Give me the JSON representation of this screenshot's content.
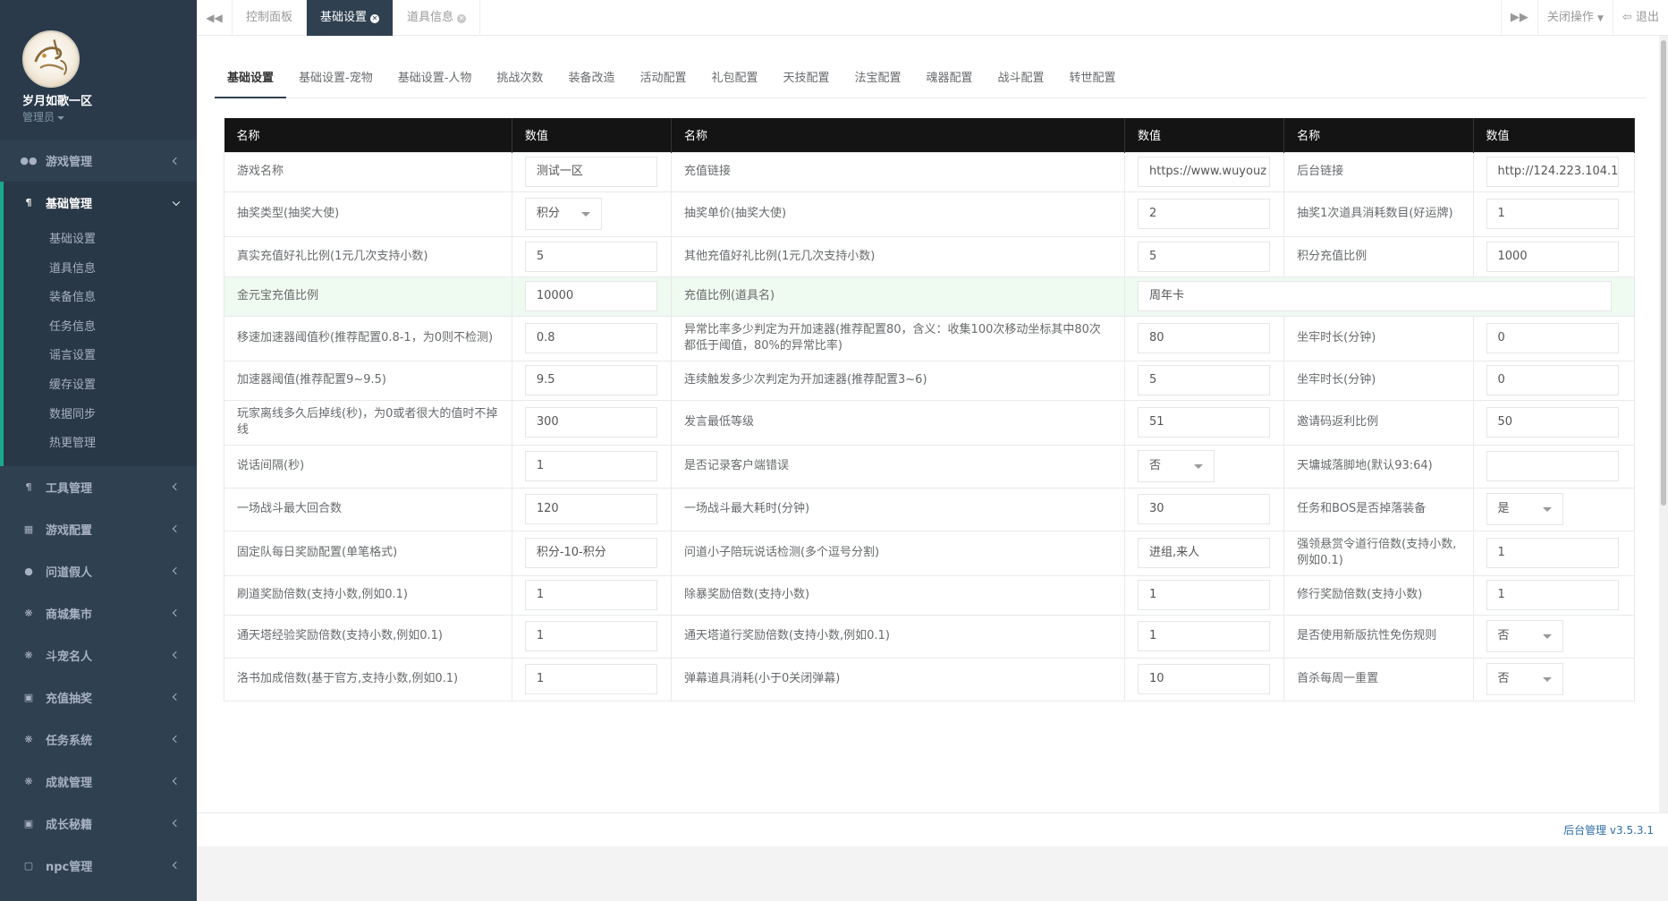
{
  "sidebar": {
    "profile": {
      "name": "岁月如歌一区",
      "role": "管理员"
    },
    "items": [
      {
        "label": "游戏管理",
        "icon": "gamepad-icon",
        "active": false
      },
      {
        "label": "基础管理",
        "icon": "cutlery-icon",
        "active": true
      },
      {
        "label": "工具管理",
        "icon": "cutlery-icon",
        "active": false
      },
      {
        "label": "游戏配置",
        "icon": "grid-icon",
        "active": false
      },
      {
        "label": "问道假人",
        "icon": "user-icon",
        "active": false
      },
      {
        "label": "商城集市",
        "icon": "gear-icon",
        "active": false
      },
      {
        "label": "斗宠名人",
        "icon": "gear-icon",
        "active": false
      },
      {
        "label": "充值抽奖",
        "icon": "money-icon",
        "active": false
      },
      {
        "label": "任务系统",
        "icon": "gear-icon",
        "active": false
      },
      {
        "label": "成就管理",
        "icon": "gear-icon",
        "active": false
      },
      {
        "label": "成长秘籍",
        "icon": "money-icon",
        "active": false
      },
      {
        "label": "npc管理",
        "icon": "square-icon",
        "active": false
      }
    ],
    "submenu": [
      "基础设置",
      "道具信息",
      "装备信息",
      "任务信息",
      "谣言设置",
      "缓存设置",
      "数据同步",
      "热更管理"
    ]
  },
  "topbar": {
    "tabs": [
      {
        "label": "控制面板",
        "active": false,
        "closable": false
      },
      {
        "label": "基础设置",
        "active": true,
        "closable": true
      },
      {
        "label": "道具信息",
        "active": false,
        "closable": true
      }
    ],
    "close_ops": "关闭操作",
    "logout": "退出"
  },
  "subtabs": [
    "基础设置",
    "基础设置-宠物",
    "基础设置-人物",
    "挑战次数",
    "装备改造",
    "活动配置",
    "礼包配置",
    "天技配置",
    "法宝配置",
    "魂器配置",
    "战斗配置",
    "转世配置"
  ],
  "table": {
    "headers": [
      "名称",
      "数值",
      "名称",
      "数值",
      "名称",
      "数值"
    ],
    "rows": [
      {
        "h": 44,
        "cells": [
          {
            "t": "label",
            "v": "游戏名称"
          },
          {
            "t": "input",
            "v": "测试一区"
          },
          {
            "t": "label",
            "v": "充值链接"
          },
          {
            "t": "input",
            "v": "https://www.wuyouz"
          },
          {
            "t": "label",
            "v": "后台链接"
          },
          {
            "t": "input",
            "v": "http://124.223.104.1"
          }
        ]
      },
      {
        "h": 50,
        "cells": [
          {
            "t": "label",
            "v": "抽奖类型(抽奖大使)"
          },
          {
            "t": "select",
            "v": "积分"
          },
          {
            "t": "label",
            "v": "抽奖单价(抽奖大使)"
          },
          {
            "t": "input",
            "v": "2"
          },
          {
            "t": "label",
            "v": "抽奖1次道具消耗数目(好运牌)"
          },
          {
            "t": "input",
            "v": "1"
          }
        ]
      },
      {
        "h": 45,
        "cells": [
          {
            "t": "label",
            "v": "真实充值好礼比例(1元几次支持小数)"
          },
          {
            "t": "input",
            "v": "5"
          },
          {
            "t": "label",
            "v": "其他充值好礼比例(1元几次支持小数)"
          },
          {
            "t": "input",
            "v": "5"
          },
          {
            "t": "label",
            "v": "积分充值比例"
          },
          {
            "t": "input",
            "v": "1000"
          }
        ]
      },
      {
        "h": 44,
        "hl": true,
        "cells": [
          {
            "t": "label",
            "v": "金元宝充值比例"
          },
          {
            "t": "input",
            "v": "10000"
          },
          {
            "t": "label",
            "v": "充值比例(道具名)"
          },
          {
            "t": "wide",
            "v": "周年卡"
          }
        ]
      },
      {
        "h": 50,
        "cells": [
          {
            "t": "label",
            "v": "移速加速器阈值秒(推荐配置0.8-1，为0则不检测)"
          },
          {
            "t": "input",
            "v": "0.8"
          },
          {
            "t": "label",
            "v": "异常比率多少判定为开加速器(推荐配置80，含义：收集100次移动坐标其中80次都低于阈值，80%的异常比率)"
          },
          {
            "t": "input",
            "v": "80"
          },
          {
            "t": "label",
            "v": "坐牢时长(分钟)"
          },
          {
            "t": "input",
            "v": "0"
          }
        ]
      },
      {
        "h": 44,
        "cells": [
          {
            "t": "label",
            "v": "加速器阈值(推荐配置9~9.5)"
          },
          {
            "t": "input",
            "v": "9.5"
          },
          {
            "t": "label",
            "v": "连续触发多少次判定为开加速器(推荐配置3~6)"
          },
          {
            "t": "input",
            "v": "5"
          },
          {
            "t": "label",
            "v": "坐牢时长(分钟)"
          },
          {
            "t": "input",
            "v": "0"
          }
        ]
      },
      {
        "h": 50,
        "cells": [
          {
            "t": "label",
            "v": "玩家离线多久后掉线(秒)，为0或者很大的值时不掉线"
          },
          {
            "t": "input",
            "v": "300"
          },
          {
            "t": "label",
            "v": "发言最低等级"
          },
          {
            "t": "input",
            "v": "51"
          },
          {
            "t": "label",
            "v": "邀请码返利比例"
          },
          {
            "t": "input",
            "v": "50"
          }
        ]
      },
      {
        "h": 48,
        "cells": [
          {
            "t": "label",
            "v": "说话间隔(秒)"
          },
          {
            "t": "input",
            "v": "1"
          },
          {
            "t": "label",
            "v": "是否记录客户端错误"
          },
          {
            "t": "select",
            "v": "否"
          },
          {
            "t": "label",
            "v": "天墉城落脚地(默认93:64)"
          },
          {
            "t": "input",
            "v": ""
          }
        ]
      },
      {
        "h": 48,
        "cells": [
          {
            "t": "label",
            "v": "一场战斗最大回合数"
          },
          {
            "t": "input",
            "v": "120"
          },
          {
            "t": "label",
            "v": "一场战斗最大耗时(分钟)"
          },
          {
            "t": "input",
            "v": "30"
          },
          {
            "t": "label",
            "v": "任务和BOS是否掉落装备"
          },
          {
            "t": "select",
            "v": "是"
          }
        ]
      },
      {
        "h": 50,
        "cells": [
          {
            "t": "label",
            "v": "固定队每日奖励配置(单笔格式)"
          },
          {
            "t": "input",
            "v": "积分-10-积分"
          },
          {
            "t": "label",
            "v": "问道小子陪玩说话检测(多个逗号分割)"
          },
          {
            "t": "input",
            "v": "进组,来人"
          },
          {
            "t": "label",
            "v": "强领悬赏令道行倍数(支持小数,例如0.1)"
          },
          {
            "t": "input",
            "v": "1"
          }
        ]
      },
      {
        "h": 44,
        "cells": [
          {
            "t": "label",
            "v": "刷道奖励倍数(支持小数,例如0.1)"
          },
          {
            "t": "input",
            "v": "1"
          },
          {
            "t": "label",
            "v": "除暴奖励倍数(支持小数)"
          },
          {
            "t": "input",
            "v": "1"
          },
          {
            "t": "label",
            "v": "修行奖励倍数(支持小数)"
          },
          {
            "t": "input",
            "v": "1"
          }
        ]
      },
      {
        "h": 48,
        "cells": [
          {
            "t": "label",
            "v": "通天塔经验奖励倍数(支持小数,例如0.1)"
          },
          {
            "t": "input",
            "v": "1"
          },
          {
            "t": "label",
            "v": "通天塔道行奖励倍数(支持小数,例如0.1)"
          },
          {
            "t": "input",
            "v": "1"
          },
          {
            "t": "label",
            "v": "是否使用新版抗性免伤规则"
          },
          {
            "t": "select",
            "v": "否"
          }
        ]
      },
      {
        "h": 48,
        "cells": [
          {
            "t": "label",
            "v": "洛书加成倍数(基于官方,支持小数,例如0.1)"
          },
          {
            "t": "input",
            "v": "1"
          },
          {
            "t": "label",
            "v": "弹幕道具消耗(小于0关闭弹幕)"
          },
          {
            "t": "input",
            "v": "10"
          },
          {
            "t": "label",
            "v": "首杀每周一重置"
          },
          {
            "t": "select",
            "v": "否"
          }
        ]
      }
    ]
  },
  "footer": {
    "version": "后台管理 v3.5.3.1"
  }
}
